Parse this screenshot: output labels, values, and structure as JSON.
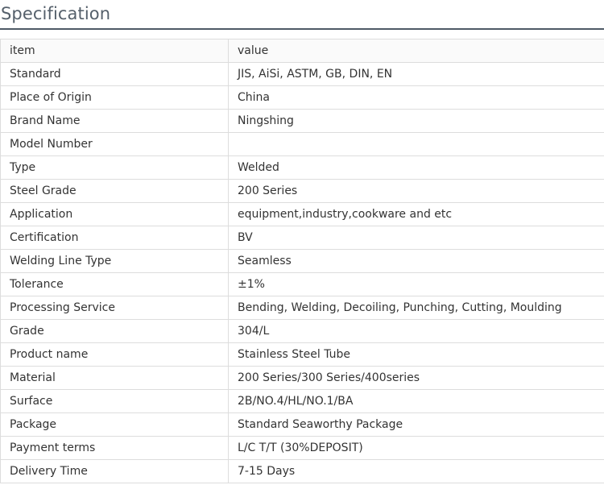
{
  "section": {
    "title": "Specification"
  },
  "table": {
    "header": {
      "key": "item",
      "value": "value"
    },
    "rows": [
      {
        "key": "Standard",
        "value": "JIS, AiSi, ASTM, GB, DIN, EN"
      },
      {
        "key": "Place of Origin",
        "value": "China"
      },
      {
        "key": "Brand Name",
        "value": "Ningshing"
      },
      {
        "key": "Model Number",
        "value": ""
      },
      {
        "key": "Type",
        "value": "Welded"
      },
      {
        "key": "Steel Grade",
        "value": "200 Series"
      },
      {
        "key": "Application",
        "value": "equipment,industry,cookware and etc"
      },
      {
        "key": "Certification",
        "value": "BV"
      },
      {
        "key": "Welding Line Type",
        "value": "Seamless"
      },
      {
        "key": "Tolerance",
        "value": "±1%"
      },
      {
        "key": "Processing Service",
        "value": "Bending, Welding, Decoiling, Punching, Cutting, Moulding"
      },
      {
        "key": "Grade",
        "value": "304/L"
      },
      {
        "key": "Product name",
        "value": "Stainless Steel Tube"
      },
      {
        "key": "Material",
        "value": "200 Series/300 Series/400series"
      },
      {
        "key": "Surface",
        "value": "2B/NO.4/HL/NO.1/BA"
      },
      {
        "key": "Package",
        "value": "Standard Seaworthy Package"
      },
      {
        "key": "Payment terms",
        "value": "L/C T/T (30%DEPOSIT)"
      },
      {
        "key": "Delivery Time",
        "value": "7-15 Days"
      }
    ]
  }
}
